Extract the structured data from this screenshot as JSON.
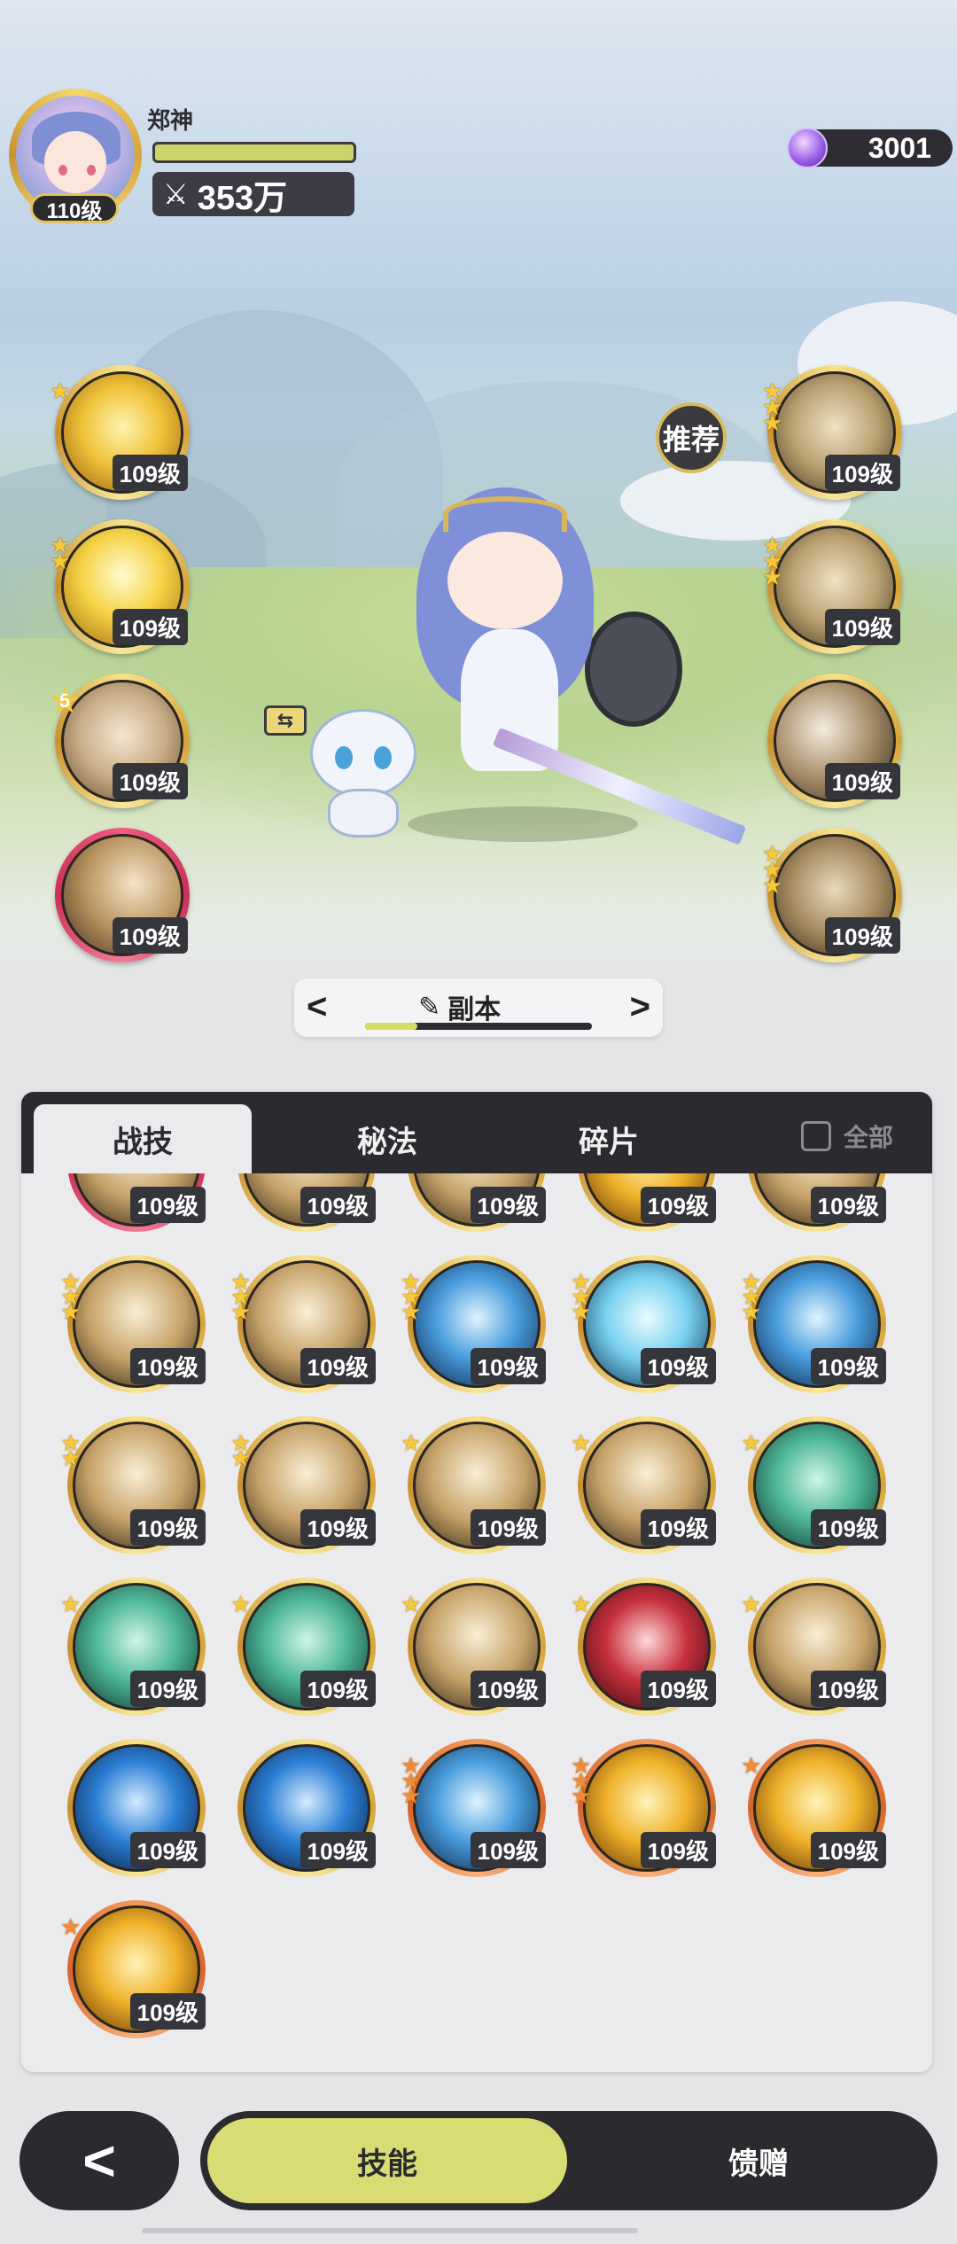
{
  "player": {
    "name": "郑神",
    "level": "110级",
    "power": "353万",
    "hp_fraction": 1.0
  },
  "currency": {
    "icon": "gem-icon",
    "amount": "3001"
  },
  "recommend_label": "推荐",
  "swap_label": "⇆",
  "left_slots": [
    {
      "level": "109级",
      "stars": 1,
      "count": ""
    },
    {
      "level": "109级",
      "stars": 2,
      "count": ""
    },
    {
      "level": "109级",
      "stars": 0,
      "count": "5"
    },
    {
      "level": "109级",
      "stars": 0,
      "count": ""
    }
  ],
  "right_slots": [
    {
      "level": "109级",
      "stars": 3
    },
    {
      "level": "109级",
      "stars": 3
    },
    {
      "level": "109级",
      "stars": 0
    },
    {
      "level": "109级",
      "stars": 3
    }
  ],
  "mode_switcher": {
    "prev": "<",
    "next": ">",
    "label": "副本",
    "progress": 0.23
  },
  "panel": {
    "tabs": [
      "战技",
      "秘法",
      "碎片"
    ],
    "active_tab": 0,
    "all_label": "全部"
  },
  "skills": [
    {
      "level": "109级",
      "stars": 0,
      "ring": "red"
    },
    {
      "level": "109级",
      "stars": 3,
      "ring": "gold"
    },
    {
      "level": "109级",
      "stars": 3,
      "ring": "gold"
    },
    {
      "level": "109级",
      "stars": 3,
      "ring": "gold"
    },
    {
      "level": "109级",
      "stars": 3,
      "ring": "gold"
    },
    {
      "level": "109级",
      "stars": 3,
      "ring": "gold"
    },
    {
      "level": "109级",
      "stars": 3,
      "ring": "gold"
    },
    {
      "level": "109级",
      "stars": 3,
      "ring": "gold"
    },
    {
      "level": "109级",
      "stars": 3,
      "ring": "gold"
    },
    {
      "level": "109级",
      "stars": 3,
      "ring": "gold"
    },
    {
      "level": "109级",
      "stars": 2,
      "ring": "gold"
    },
    {
      "level": "109级",
      "stars": 2,
      "ring": "gold"
    },
    {
      "level": "109级",
      "stars": 1,
      "ring": "gold"
    },
    {
      "level": "109级",
      "stars": 1,
      "ring": "gold"
    },
    {
      "level": "109级",
      "stars": 1,
      "ring": "gold"
    },
    {
      "level": "109级",
      "stars": 1,
      "ring": "gold"
    },
    {
      "level": "109级",
      "stars": 1,
      "ring": "gold"
    },
    {
      "level": "109级",
      "stars": 1,
      "ring": "gold"
    },
    {
      "level": "109级",
      "stars": 1,
      "ring": "gold"
    },
    {
      "level": "109级",
      "stars": 1,
      "ring": "gold"
    },
    {
      "level": "109级",
      "stars": 0,
      "ring": "gold"
    },
    {
      "level": "109级",
      "stars": 0,
      "ring": "gold"
    },
    {
      "level": "109级",
      "stars": 3,
      "ring": "orange"
    },
    {
      "level": "109级",
      "stars": 3,
      "ring": "orange"
    },
    {
      "level": "109级",
      "stars": 1,
      "ring": "orange"
    },
    {
      "level": "109级",
      "stars": 1,
      "ring": "orange"
    }
  ],
  "bottom_nav": {
    "back": "<",
    "tabs": [
      "技能",
      "馈赠"
    ],
    "active": 0
  }
}
